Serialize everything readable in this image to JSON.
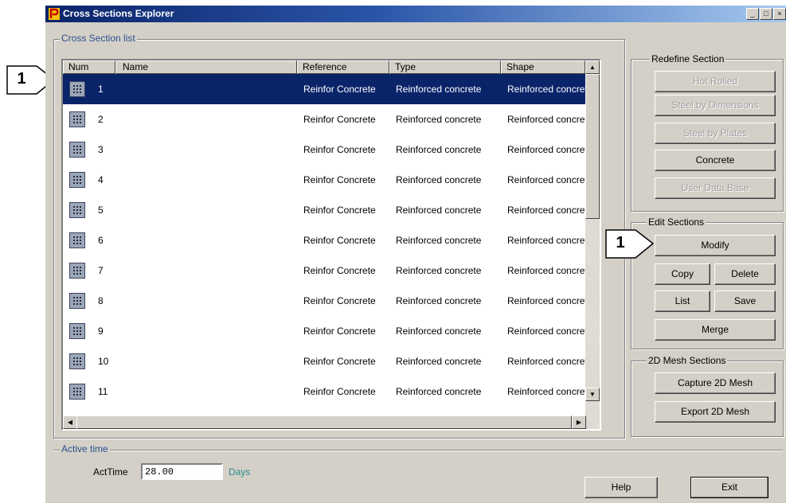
{
  "window": {
    "title": "Cross Sections Explorer",
    "controls": [
      "_",
      "□",
      "×"
    ]
  },
  "cross_section_list": {
    "group_label": "Cross Section list",
    "columns": [
      "Num",
      "Name",
      "Reference",
      "Type",
      "Shape"
    ],
    "rows": [
      {
        "num": "1",
        "name": "",
        "reference": "Reinfor Concrete",
        "type": "Reinforced concrete",
        "shape": "Reinforced concrete",
        "selected": true
      },
      {
        "num": "2",
        "name": "",
        "reference": "Reinfor Concrete",
        "type": "Reinforced concrete",
        "shape": "Reinforced concrete",
        "selected": false
      },
      {
        "num": "3",
        "name": "",
        "reference": "Reinfor Concrete",
        "type": "Reinforced concrete",
        "shape": "Reinforced concrete",
        "selected": false
      },
      {
        "num": "4",
        "name": "",
        "reference": "Reinfor Concrete",
        "type": "Reinforced concrete",
        "shape": "Reinforced concrete",
        "selected": false
      },
      {
        "num": "5",
        "name": "",
        "reference": "Reinfor Concrete",
        "type": "Reinforced concrete",
        "shape": "Reinforced concrete",
        "selected": false
      },
      {
        "num": "6",
        "name": "",
        "reference": "Reinfor Concrete",
        "type": "Reinforced concrete",
        "shape": "Reinforced concrete",
        "selected": false
      },
      {
        "num": "7",
        "name": "",
        "reference": "Reinfor Concrete",
        "type": "Reinforced concrete",
        "shape": "Reinforced concrete",
        "selected": false
      },
      {
        "num": "8",
        "name": "",
        "reference": "Reinfor Concrete",
        "type": "Reinforced concrete",
        "shape": "Reinforced concrete",
        "selected": false
      },
      {
        "num": "9",
        "name": "",
        "reference": "Reinfor Concrete",
        "type": "Reinforced concrete",
        "shape": "Reinforced concrete",
        "selected": false
      },
      {
        "num": "10",
        "name": "",
        "reference": "Reinfor Concrete",
        "type": "Reinforced concrete",
        "shape": "Reinforced concrete",
        "selected": false
      },
      {
        "num": "11",
        "name": "",
        "reference": "Reinfor Concrete",
        "type": "Reinforced concrete",
        "shape": "Reinforced concrete",
        "selected": false
      }
    ]
  },
  "redefine_section": {
    "label": "Redefine Section",
    "hot_rolled": "Hot Rolled",
    "steel_by_dimensions": "Steel by Dimensions",
    "steel_by_plates": "Steel by Plates",
    "concrete": "Concrete",
    "user_data_base": "User Data Base"
  },
  "edit_sections": {
    "label": "Edit Sections",
    "modify": "Modify",
    "copy": "Copy",
    "delete": "Delete",
    "list": "List",
    "save": "Save",
    "merge": "Merge"
  },
  "mesh_sections": {
    "label": "2D Mesh Sections",
    "capture": "Capture 2D Mesh",
    "export": "Export 2D Mesh"
  },
  "active_time": {
    "group_label": "Active time",
    "field_label": "ActTime",
    "value": "28.00",
    "unit": "Days"
  },
  "footer": {
    "help": "Help",
    "exit": "Exit"
  },
  "callouts": {
    "left": "1",
    "right": "1"
  },
  "colors": {
    "selection": "#0a246a",
    "group_label_blue": "#2b4f8f",
    "unit_teal": "#2a8a8a"
  }
}
